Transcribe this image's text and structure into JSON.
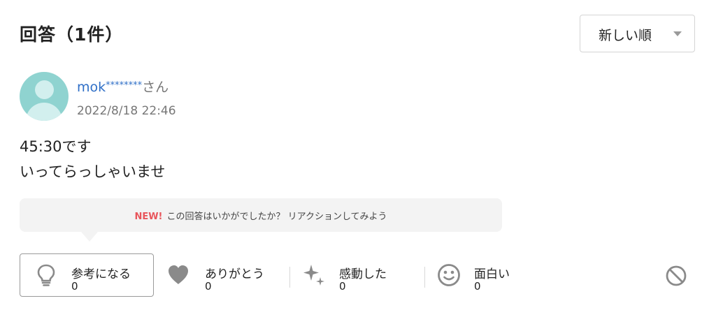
{
  "header": {
    "title": "回答（1件）"
  },
  "sort": {
    "selected": "新しい順"
  },
  "answer": {
    "user_name": "mok",
    "user_mask": "********",
    "user_suffix": "さん",
    "timestamp": "2022/8/18 22:46",
    "body_lines": [
      "45:30です",
      "いってらっしゃいませ"
    ]
  },
  "banner": {
    "new_label": "NEW!",
    "text": "この回答はいかがでしたか？ リアクションしてみよう"
  },
  "reactions": [
    {
      "label": "参考になる",
      "count": "0",
      "icon": "lightbulb-icon"
    },
    {
      "label": "ありがとう",
      "count": "0",
      "icon": "heart-icon"
    },
    {
      "label": "感動した",
      "count": "0",
      "icon": "sparkle-icon"
    },
    {
      "label": "面白い",
      "count": "0",
      "icon": "smile-icon"
    }
  ],
  "colors": {
    "link": "#2f6fc7",
    "new_badge": "#e8555b",
    "avatar": "#8fd3d0",
    "icon": "#8a8a8a"
  }
}
